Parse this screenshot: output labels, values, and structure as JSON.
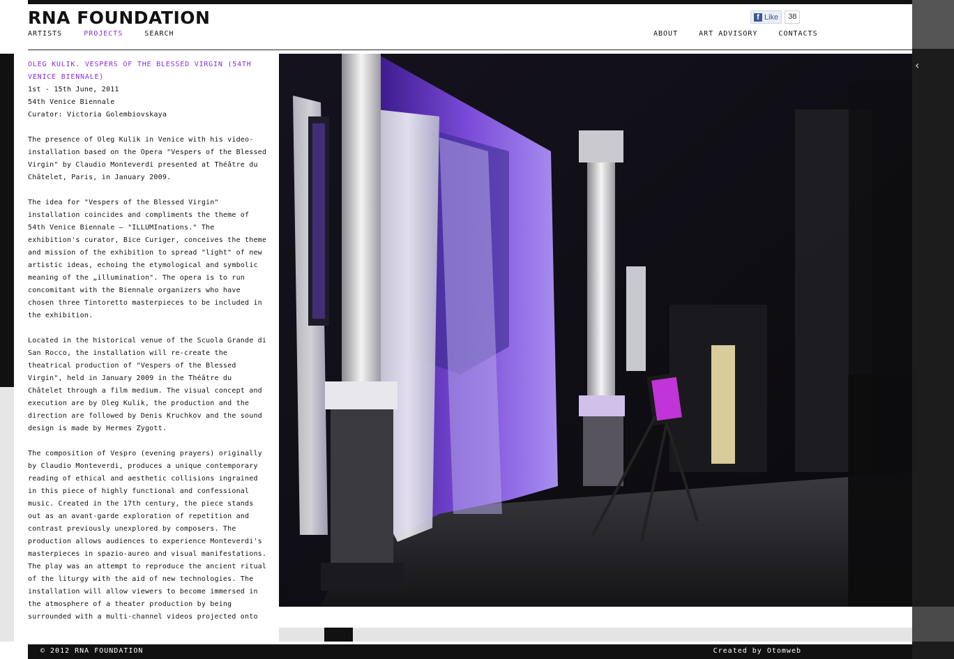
{
  "header": {
    "logo": "RNA FOUNDATION",
    "nav_left": [
      "ARTISTS",
      "PROJECTS",
      "SEARCH"
    ],
    "nav_right": [
      "ABOUT",
      "ART ADVISORY",
      "CONTACTS"
    ],
    "active_nav": "PROJECTS",
    "facebook": {
      "label": "Like",
      "count": "38"
    }
  },
  "article": {
    "title": "OLEG KULIK. VESPERS OF THE BLESSED VIRGIN (54TH VENICE BIENNALE)",
    "meta": [
      "1st - 15th June, 2011",
      "54th Venice Biennale",
      "Curator: Victoria Golembiovskaya"
    ],
    "paragraphs": [
      "The presence of Oleg Kulik in Venice with his video-installation based on the Opera \"Vespers of the Blessed Virgin\" by Claudio Monteverdi presented at Théâtre du Châtelet, Paris, in January 2009.",
      "The idea for \"Vespers of the Blessed Virgin\" installation coincides and compliments the theme of 54th Venice Biennale – \"ILLUMInations.\" The exhibition's curator, Bice Curiger, conceives the theme and mission of the exhibition to spread \"light\" of new artistic ideas, echoing the etymological and symbolic meaning of the „illumination\". The opera is to run concomitant with the Biennale organizers who have chosen three Tintoretto masterpieces to be included in the exhibition.",
      "Located in the historical venue of the Scuola Grande di San Rocco, the installation will re-create the theatrical production of \"Vespers of the Blessed Virgin\", held in January 2009 in the Théâtre du Châtelet through a film medium. The visual concept and execution are by Oleg Kulik, the production and the direction are followed by Denis Kruchkov and the sound design is made by Hermes Zygott.",
      "The composition of Vespro (evening prayers) originally by Claudio Monteverdi, produces a unique contemporary reading of ethical and aesthetic collisions ingrained in this piece of highly functional and confessional music. Created in the 17th century, the piece stands out as an avant-garde exploration of repetition and contrast previously unexplored by composers. The production allows audiences to experience Monteverdi's masterpieces in spazio-aureo and visual manifestations. The play was an attempt to reproduce the ancient ritual of the liturgy with the aid of new technologies. The installation will allow viewers to become immersed in the atmosphere of a theater production by being surrounded with a multi-channel videos projected onto"
    ]
  },
  "gallery": {
    "prev_icon": "chevron-left-icon",
    "accent_color": "#8a2be2"
  },
  "footer": {
    "copyright": "© 2012 RNA FOUNDATION",
    "credit": "Created by Otomweb"
  }
}
